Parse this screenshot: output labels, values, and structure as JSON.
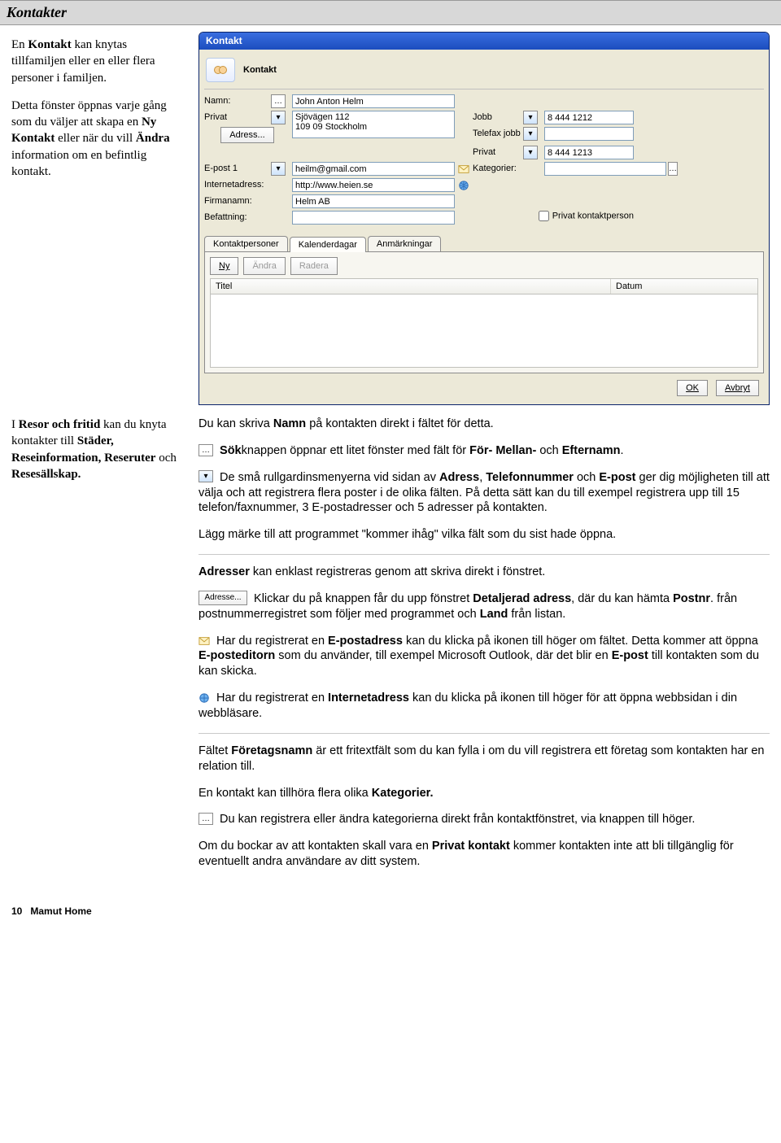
{
  "header": {
    "title": "Kontakter"
  },
  "intro": {
    "p1a": "En ",
    "p1b": "Kontakt",
    "p1c": " kan knytas tillfamiljen eller en eller flera personer i familjen.",
    "p2a": "Detta fönster öppnas varje gång som du väljer att skapa en ",
    "p2b": "Ny Kontakt",
    "p2c": " eller när du vill ",
    "p2d": "Ändra",
    "p2e": " information om en befintlig kontakt."
  },
  "window": {
    "title": "Kontakt",
    "section": "Kontakt",
    "labels": {
      "namn": "Namn:",
      "privat": "Privat",
      "adress": "Adress...",
      "epost1": "E-post 1",
      "internet": "Internetadress:",
      "firma": "Firmanamn:",
      "befattning": "Befattning:",
      "jobb": "Jobb",
      "telefax": "Telefax jobb",
      "privat2": "Privat",
      "kategori": "Kategorier:",
      "privatkp": "Privat kontaktperson"
    },
    "values": {
      "namn": "John Anton Helm",
      "adress": "Sjövägen 112\n109 09 Stockholm",
      "epost1": "heilm@gmail.com",
      "internet": "http://www.heien.se",
      "firma": "Helm AB",
      "jobb": "8 444 1212",
      "privat2": "8 444 1213"
    },
    "tabs": [
      "Kontaktpersoner",
      "Kalenderdagar",
      "Anmärkningar"
    ],
    "tab_active": 1,
    "tab_btns": {
      "ny": "Ny",
      "andra": "Ändra",
      "radera": "Radera"
    },
    "list_cols": [
      "Titel",
      "Datum"
    ],
    "ok": "OK",
    "avbryt": "Avbryt"
  },
  "side": {
    "p1a": "I ",
    "p1b": "Resor och fritid",
    "p1c": " kan du knyta kontakter till ",
    "p1d": "Städer, Reseinformation, Reseruter",
    "p1e": " och ",
    "p1f": "Resesällskap."
  },
  "body": {
    "p1a": "Du kan skriva ",
    "p1b": "Namn",
    "p1c": " på kontakten direkt i fältet för detta.",
    "p2a": " ",
    "p2b": "Sök",
    "p2c": "knappen öppnar ett litet fönster med fält för ",
    "p2d": "För-",
    "p2e": " ",
    "p2f": "Mellan-",
    "p2g": " och ",
    "p2h": "Efternamn",
    "p2i": ".",
    "p3a": " De små rullgardinsmenyerna vid sidan av ",
    "p3b": "Adress",
    "p3c": ", ",
    "p3d": "Telefonnummer",
    "p3e": " och ",
    "p3f": "E-post",
    "p3g": " ger dig möjligheten till att välja och att registrera flera poster i de olika fälten. På detta sätt kan du till exempel registrera upp till 15 telefon/faxnummer, 3 E-postadresser och 5 adresser på kontakten.",
    "p4": "Lägg märke till att programmet \"kommer ihåg\" vilka fält som du sist hade öppna.",
    "p5a": "Adresser",
    "p5b": " kan enklast registreras genom att skriva direkt i fönstret.",
    "p6_btn": "Adresse...",
    "p6a": " Klickar du på knappen får du upp fönstret ",
    "p6b": "Detaljerad adress",
    "p6c": ", där du kan hämta ",
    "p6d": "Postnr",
    "p6e": ". från postnummerregistret som följer med programmet och ",
    "p6f": "Land",
    "p6g": " från listan.",
    "p7a": " Har du registrerat en ",
    "p7b": "E-postadress",
    "p7c": " kan du klicka på ikonen till höger om fältet. Detta kommer att öppna ",
    "p7d": "E-posteditorn",
    "p7e": " som du använder, till exempel Microsoft Outlook, där det blir en ",
    "p7f": "E-post",
    "p7g": " till kontakten som du kan skicka.",
    "p8a": " Har du registrerat en ",
    "p8b": "Internetadress",
    "p8c": " kan du klicka på ikonen till höger för att öppna webbsidan i din webbläsare.",
    "p9a": "Fältet ",
    "p9b": "Företagsnamn",
    "p9c": " är ett fritextfält som du kan fylla i om du vill registrera ett företag som kontakten har en relation till.",
    "p10a": "En kontakt kan tillhöra flera olika ",
    "p10b": "Kategorier.",
    "p11a": " Du kan registrera eller ändra kategorierna direkt från kontaktfönstret, via knappen till höger.",
    "p12a": "Om du bockar av att kontakten skall vara en ",
    "p12b": "Privat kontakt",
    "p12c": " kommer kontakten inte att bli tillgänglig för eventuellt andra användare av ditt system."
  },
  "footer": {
    "page": "10",
    "book": "Mamut Home"
  }
}
